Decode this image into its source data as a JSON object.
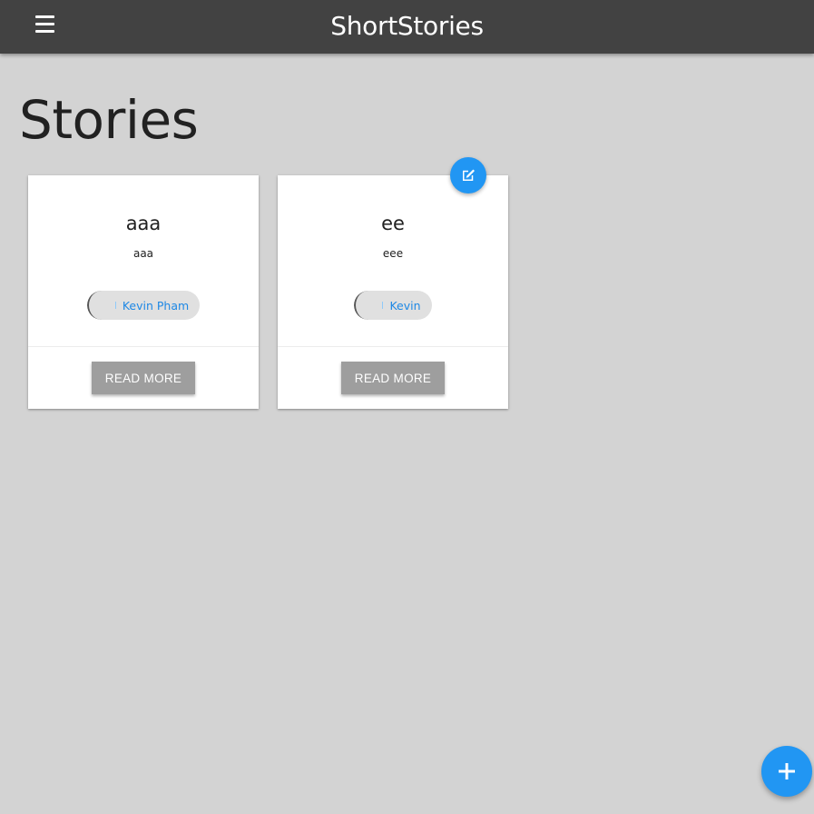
{
  "appbar": {
    "title": "ShortStories"
  },
  "page": {
    "title": "Stories"
  },
  "stories": [
    {
      "title": "aaa",
      "subtitle": "aaa",
      "author": "Kevin Pham",
      "button_label": "READ MORE"
    },
    {
      "title": "ee",
      "subtitle": "eee",
      "author": "Kevin",
      "button_label": "READ MORE"
    }
  ],
  "icons": {
    "menu": "menu-icon",
    "edit": "edit-icon",
    "add": "plus-icon"
  },
  "colors": {
    "appbar": "#424242",
    "background": "#d3d3d3",
    "accent": "#2196f3",
    "button": "#9e9e9e",
    "chip_text": "#1e88e5"
  }
}
